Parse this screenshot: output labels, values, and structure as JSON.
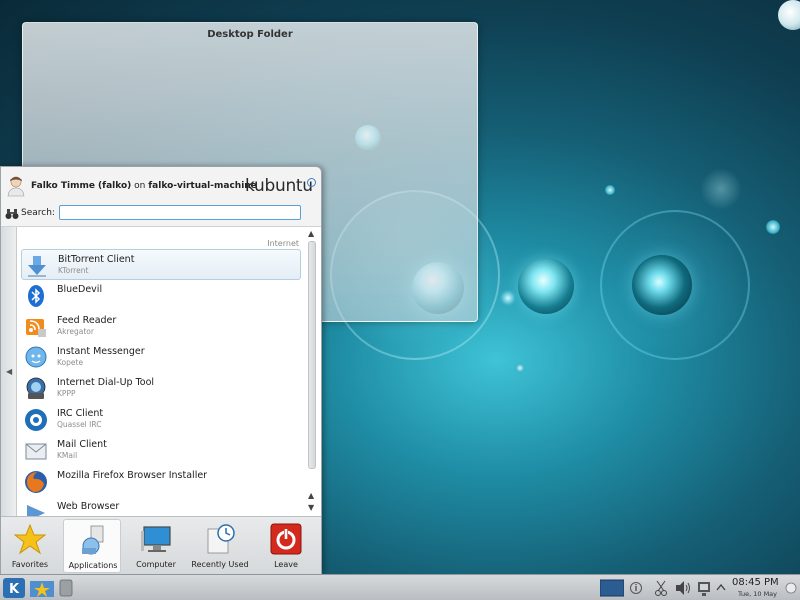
{
  "desktop_folder": {
    "title": "Desktop Folder"
  },
  "kickoff": {
    "user_display_name": "Falko Timme (falko)",
    "on_text": "on",
    "host": "falko-virtual-machine",
    "logo_text": "kubuntu",
    "search_label": "Search:",
    "search_value": "",
    "category": "Internet",
    "items": [
      {
        "name": "BitTorrent Client",
        "subtitle": "KTorrent",
        "icon": "download-arrow-icon"
      },
      {
        "name": "BlueDevil",
        "subtitle": "",
        "icon": "bluetooth-icon"
      },
      {
        "name": "Feed Reader",
        "subtitle": "Akregator",
        "icon": "rss-feed-icon"
      },
      {
        "name": "Instant Messenger",
        "subtitle": "Kopete",
        "icon": "chat-bubble-icon"
      },
      {
        "name": "Internet Dial-Up Tool",
        "subtitle": "KPPP",
        "icon": "dialup-icon"
      },
      {
        "name": "IRC Client",
        "subtitle": "Quassel IRC",
        "icon": "irc-icon"
      },
      {
        "name": "Mail Client",
        "subtitle": "KMail",
        "icon": "mail-icon"
      },
      {
        "name": "Mozilla Firefox Browser Installer",
        "subtitle": "",
        "icon": "firefox-icon"
      },
      {
        "name": "Web Browser",
        "subtitle": "",
        "icon": "web-browser-icon"
      }
    ],
    "tabs": [
      {
        "label": "Favorites",
        "icon": "star-icon"
      },
      {
        "label": "Applications",
        "icon": "applications-icon"
      },
      {
        "label": "Computer",
        "icon": "monitor-icon"
      },
      {
        "label": "Recently Used",
        "icon": "recent-documents-icon"
      },
      {
        "label": "Leave",
        "icon": "power-icon"
      }
    ],
    "active_tab": "Applications"
  },
  "taskbar": {
    "clock_time": "08:45 PM",
    "clock_date": "Tue, 10 May"
  },
  "colors": {
    "accent": "#5aa1d8",
    "leave_red": "#d42a1e",
    "wallpaper_cyan": "#3fc3d6"
  }
}
